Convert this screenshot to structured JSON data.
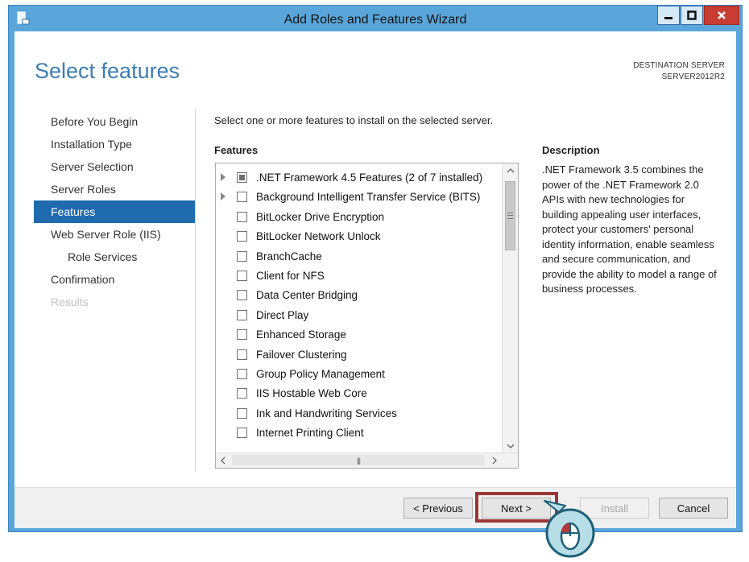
{
  "window": {
    "title": "Add Roles and Features Wizard",
    "icons": {
      "app": "server-manager-icon",
      "minimize": "minimize-icon",
      "maximize": "maximize-icon",
      "close": "close-icon"
    },
    "colors": {
      "frame": "#5aa6da",
      "close": "#c83c32",
      "accent": "#1f6bae"
    }
  },
  "page": {
    "title": "Select features"
  },
  "destination": {
    "label": "DESTINATION SERVER",
    "server": "SERVER2012R2"
  },
  "nav": {
    "items": [
      {
        "label": "Before You Begin",
        "state": "normal"
      },
      {
        "label": "Installation Type",
        "state": "normal"
      },
      {
        "label": "Server Selection",
        "state": "normal"
      },
      {
        "label": "Server Roles",
        "state": "normal"
      },
      {
        "label": "Features",
        "state": "selected"
      },
      {
        "label": "Web Server Role (IIS)",
        "state": "normal"
      },
      {
        "label": "Role Services",
        "state": "sub"
      },
      {
        "label": "Confirmation",
        "state": "normal"
      },
      {
        "label": "Results",
        "state": "disabled"
      }
    ]
  },
  "main": {
    "instruction": "Select one or more features to install on the selected server.",
    "features_label": "Features",
    "features": [
      {
        "label": ".NET Framework 4.5 Features (2 of 7 installed)",
        "expandable": true,
        "state": "partial"
      },
      {
        "label": "Background Intelligent Transfer Service (BITS)",
        "expandable": true,
        "state": "unchecked"
      },
      {
        "label": "BitLocker Drive Encryption",
        "expandable": false,
        "state": "unchecked"
      },
      {
        "label": "BitLocker Network Unlock",
        "expandable": false,
        "state": "unchecked"
      },
      {
        "label": "BranchCache",
        "expandable": false,
        "state": "unchecked"
      },
      {
        "label": "Client for NFS",
        "expandable": false,
        "state": "unchecked"
      },
      {
        "label": "Data Center Bridging",
        "expandable": false,
        "state": "unchecked"
      },
      {
        "label": "Direct Play",
        "expandable": false,
        "state": "unchecked"
      },
      {
        "label": "Enhanced Storage",
        "expandable": false,
        "state": "unchecked"
      },
      {
        "label": "Failover Clustering",
        "expandable": false,
        "state": "unchecked"
      },
      {
        "label": "Group Policy Management",
        "expandable": false,
        "state": "unchecked"
      },
      {
        "label": "IIS Hostable Web Core",
        "expandable": false,
        "state": "unchecked"
      },
      {
        "label": "Ink and Handwriting Services",
        "expandable": false,
        "state": "unchecked"
      },
      {
        "label": "Internet Printing Client",
        "expandable": false,
        "state": "unchecked"
      }
    ],
    "description_label": "Description",
    "description": ".NET Framework 3.5 combines the power of the .NET Framework 2.0 APIs with new technologies for building appealing user interfaces, protect your customers' personal identity information, enable seamless and secure communication, and provide the ability to model a range of business processes."
  },
  "footer": {
    "previous": "< Previous",
    "next": "Next >",
    "install": "Install",
    "cancel": "Cancel"
  },
  "cursor_icon": "mouse-pointer-icon"
}
